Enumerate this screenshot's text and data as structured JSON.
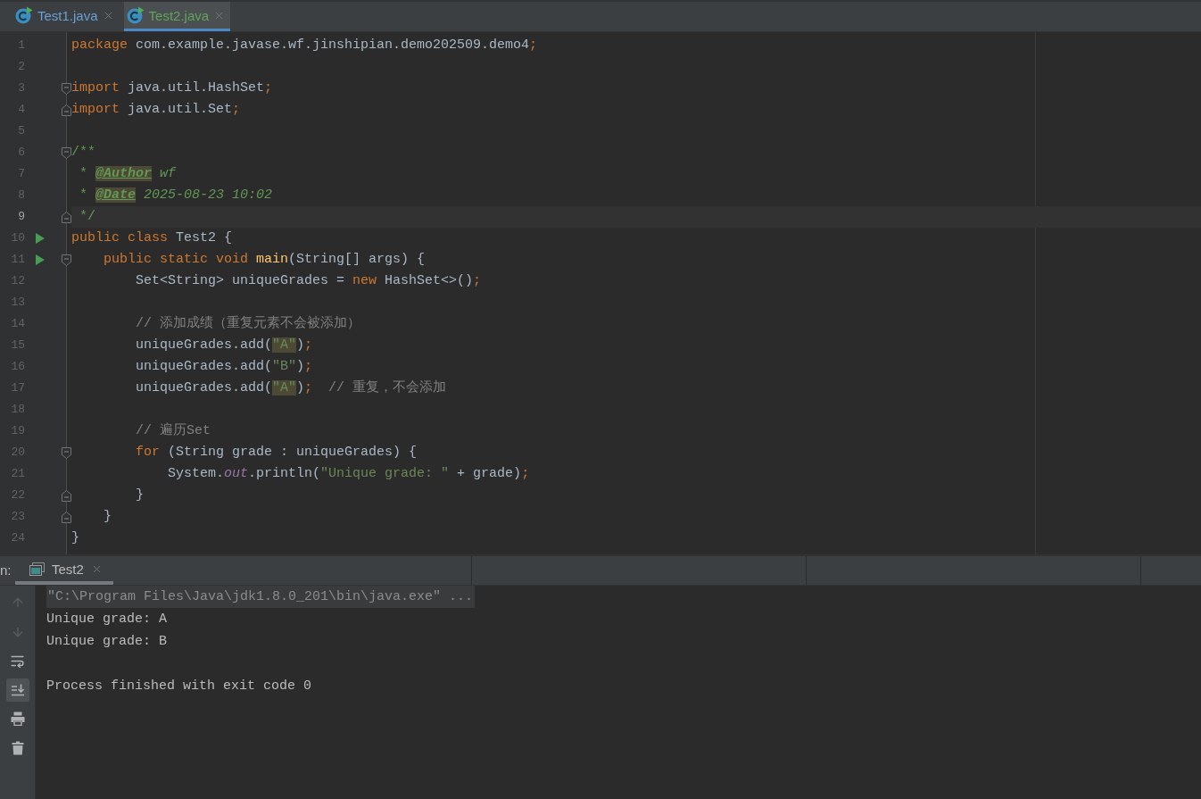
{
  "editor_tabs": [
    {
      "label": "Test1.java",
      "selected": false,
      "color": "#6a9fd4"
    },
    {
      "label": "Test2.java",
      "selected": true,
      "color": "#62a35b"
    }
  ],
  "editor": {
    "lines": [
      {
        "number": "1",
        "current": false,
        "run": false,
        "fold_start": false,
        "fold_end": false,
        "tokens": [
          {
            "kind": "keyword",
            "text": "package",
            "highlighted": false
          },
          {
            "kind": "plain",
            "text": " com.example.javase.wf.jinshipian.demo202509.demo4",
            "highlighted": false
          },
          {
            "kind": "keyword",
            "text": ";",
            "highlighted": false
          }
        ]
      },
      {
        "number": "2",
        "current": false,
        "run": false,
        "fold_start": false,
        "fold_end": false
      },
      {
        "number": "3",
        "current": false,
        "run": false,
        "fold_start": true,
        "fold_end": false,
        "tokens": [
          {
            "kind": "keyword",
            "text": "import",
            "highlighted": false
          },
          {
            "kind": "plain",
            "text": " java.util.HashSet",
            "highlighted": false
          },
          {
            "kind": "keyword",
            "text": ";",
            "highlighted": false
          }
        ]
      },
      {
        "number": "4",
        "current": false,
        "run": false,
        "fold_start": false,
        "fold_end": true,
        "tokens": [
          {
            "kind": "keyword",
            "text": "import",
            "highlighted": false
          },
          {
            "kind": "plain",
            "text": " java.util.Set",
            "highlighted": false
          },
          {
            "kind": "keyword",
            "text": ";",
            "highlighted": false
          }
        ]
      },
      {
        "number": "5",
        "current": false,
        "run": false,
        "fold_start": false,
        "fold_end": false
      },
      {
        "number": "6",
        "current": false,
        "run": false,
        "fold_start": true,
        "fold_end": false,
        "tokens": [
          {
            "kind": "doc",
            "text": "/**",
            "highlighted": false
          }
        ]
      },
      {
        "number": "7",
        "current": false,
        "run": false,
        "fold_start": false,
        "fold_end": false,
        "tokens": [
          {
            "kind": "doc",
            "text": " * ",
            "highlighted": false
          },
          {
            "kind": "doc-tag",
            "text": "@Author",
            "highlighted": true
          },
          {
            "kind": "doc-text",
            "text": " wf",
            "highlighted": false
          }
        ]
      },
      {
        "number": "8",
        "current": false,
        "run": false,
        "fold_start": false,
        "fold_end": false,
        "tokens": [
          {
            "kind": "doc",
            "text": " * ",
            "highlighted": false
          },
          {
            "kind": "doc-tag",
            "text": "@Date",
            "highlighted": true
          },
          {
            "kind": "doc-text",
            "text": " 2025-08-23 10:02",
            "highlighted": false
          }
        ]
      },
      {
        "number": "9",
        "current": true,
        "run": false,
        "fold_start": false,
        "fold_end": true,
        "tokens": [
          {
            "kind": "doc",
            "text": " */",
            "highlighted": false
          }
        ]
      },
      {
        "number": "10",
        "current": false,
        "run": true,
        "fold_start": false,
        "fold_end": false,
        "tokens": [
          {
            "kind": "keyword",
            "text": "public class",
            "highlighted": false
          },
          {
            "kind": "plain",
            "text": " Test2 {",
            "highlighted": false
          }
        ]
      },
      {
        "number": "11",
        "current": false,
        "run": true,
        "fold_start": true,
        "fold_end": false,
        "tokens": [
          {
            "kind": "keyword",
            "text": "    public static void ",
            "highlighted": false
          },
          {
            "kind": "method",
            "text": "main",
            "highlighted": false
          },
          {
            "kind": "plain",
            "text": "(String[] args) {",
            "highlighted": false
          }
        ]
      },
      {
        "number": "12",
        "current": false,
        "run": false,
        "fold_start": false,
        "fold_end": false,
        "tokens": [
          {
            "kind": "plain",
            "text": "        Set<String> uniqueGrades = ",
            "highlighted": false
          },
          {
            "kind": "keyword",
            "text": "new",
            "highlighted": false
          },
          {
            "kind": "plain",
            "text": " HashSet<>()",
            "highlighted": false
          },
          {
            "kind": "keyword",
            "text": ";",
            "highlighted": false
          }
        ]
      },
      {
        "number": "13",
        "current": false,
        "run": false,
        "fold_start": false,
        "fold_end": false
      },
      {
        "number": "14",
        "current": false,
        "run": false,
        "fold_start": false,
        "fold_end": false,
        "tokens": [
          {
            "kind": "comment",
            "text": "        // 添加成绩（重复元素不会被添加）",
            "highlighted": false
          }
        ]
      },
      {
        "number": "15",
        "current": false,
        "run": false,
        "fold_start": false,
        "fold_end": false,
        "tokens": [
          {
            "kind": "plain",
            "text": "        uniqueGrades.add(",
            "highlighted": false
          },
          {
            "kind": "string",
            "text": "\"A\"",
            "highlighted": true
          },
          {
            "kind": "plain",
            "text": ")",
            "highlighted": false
          },
          {
            "kind": "keyword",
            "text": ";",
            "highlighted": false
          }
        ]
      },
      {
        "number": "16",
        "current": false,
        "run": false,
        "fold_start": false,
        "fold_end": false,
        "tokens": [
          {
            "kind": "plain",
            "text": "        uniqueGrades.add(",
            "highlighted": false
          },
          {
            "kind": "string",
            "text": "\"B\"",
            "highlighted": false
          },
          {
            "kind": "plain",
            "text": ")",
            "highlighted": false
          },
          {
            "kind": "keyword",
            "text": ";",
            "highlighted": false
          }
        ]
      },
      {
        "number": "17",
        "current": false,
        "run": false,
        "fold_start": false,
        "fold_end": false,
        "tokens": [
          {
            "kind": "plain",
            "text": "        uniqueGrades.add(",
            "highlighted": false
          },
          {
            "kind": "string",
            "text": "\"A\"",
            "highlighted": true
          },
          {
            "kind": "plain",
            "text": ")",
            "highlighted": false
          },
          {
            "kind": "keyword",
            "text": ";",
            "highlighted": false
          },
          {
            "kind": "comment",
            "text": "  // 重复，不会添加",
            "highlighted": false
          }
        ]
      },
      {
        "number": "18",
        "current": false,
        "run": false,
        "fold_start": false,
        "fold_end": false
      },
      {
        "number": "19",
        "current": false,
        "run": false,
        "fold_start": false,
        "fold_end": false,
        "tokens": [
          {
            "kind": "comment",
            "text": "        // 遍历Set",
            "highlighted": false
          }
        ]
      },
      {
        "number": "20",
        "current": false,
        "run": false,
        "fold_start": true,
        "fold_end": false,
        "tokens": [
          {
            "kind": "keyword",
            "text": "        for",
            "highlighted": false
          },
          {
            "kind": "plain",
            "text": " (String grade : uniqueGrades) {",
            "highlighted": false
          }
        ]
      },
      {
        "number": "21",
        "current": false,
        "run": false,
        "fold_start": false,
        "fold_end": false,
        "tokens": [
          {
            "kind": "plain",
            "text": "            System.",
            "highlighted": false
          },
          {
            "kind": "field",
            "text": "out",
            "highlighted": false
          },
          {
            "kind": "plain",
            "text": ".println(",
            "highlighted": false
          },
          {
            "kind": "string",
            "text": "\"Unique grade: \"",
            "highlighted": false
          },
          {
            "kind": "plain",
            "text": " + grade)",
            "highlighted": false
          },
          {
            "kind": "keyword",
            "text": ";",
            "highlighted": false
          }
        ]
      },
      {
        "number": "22",
        "current": false,
        "run": false,
        "fold_start": false,
        "fold_end": true,
        "tokens": [
          {
            "kind": "plain",
            "text": "        }",
            "highlighted": false
          }
        ]
      },
      {
        "number": "23",
        "current": false,
        "run": false,
        "fold_start": false,
        "fold_end": true,
        "tokens": [
          {
            "kind": "plain",
            "text": "    }",
            "highlighted": false
          }
        ]
      },
      {
        "number": "24",
        "current": false,
        "run": false,
        "fold_start": false,
        "fold_end": false,
        "tokens": [
          {
            "kind": "plain",
            "text": "}",
            "highlighted": false
          }
        ]
      }
    ]
  },
  "run_panel": {
    "label": "n:",
    "tabs": [
      {
        "label": "Test2",
        "selected": true
      }
    ],
    "toolbar": [
      {
        "kind": "up",
        "disabled": true,
        "selected": false
      },
      {
        "kind": "down",
        "disabled": true,
        "selected": false
      },
      {
        "kind": "wrap",
        "disabled": false,
        "selected": false
      },
      {
        "kind": "scroll-end",
        "disabled": false,
        "selected": true
      },
      {
        "kind": "print",
        "disabled": false,
        "selected": false
      },
      {
        "kind": "delete",
        "disabled": false,
        "selected": false
      }
    ],
    "console": [
      {
        "kind": "command",
        "text": "\"C:\\Program Files\\Java\\jdk1.8.0_201\\bin\\java.exe\" ..."
      },
      {
        "kind": "output",
        "text": "Unique grade: A"
      },
      {
        "kind": "output",
        "text": "Unique grade: B"
      },
      {
        "kind": "exit",
        "text": "Process finished with exit code 0"
      }
    ]
  }
}
